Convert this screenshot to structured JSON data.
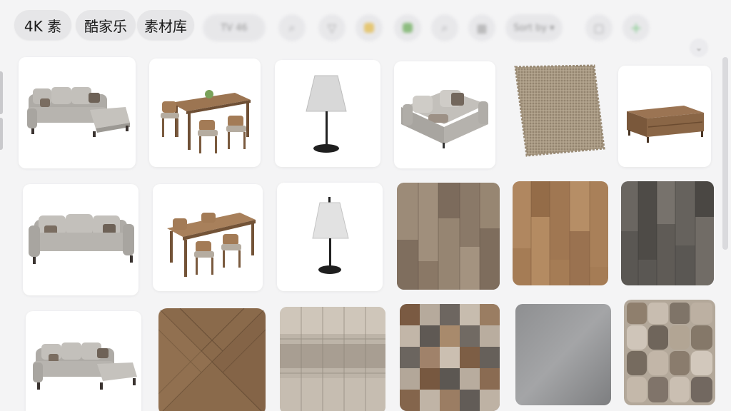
{
  "toolbar": {
    "chips": [
      {
        "label": "4K 素"
      },
      {
        "label": "酷家乐"
      },
      {
        "label": "素材库"
      }
    ],
    "blurred_pill_text": "TV 46",
    "blurred_dropdown_text": "Sort by ▾",
    "icons": [
      "search-icon",
      "filter-icon",
      "bell-icon",
      "palette-icon",
      "zoom-icon",
      "grid-icon",
      "sort-dropdown",
      "square-icon",
      "add-icon"
    ]
  },
  "grid": {
    "rows": [
      [
        "sectional-sofa",
        "dining-set",
        "table-lamp",
        "loveseat-sofa",
        "jute-rug",
        "coffee-table"
      ],
      [
        "three-seat-sofa",
        "dining-set",
        "table-lamp",
        "wood-floor-oak",
        "wood-floor-natural",
        "wood-floor-grey"
      ],
      [
        "sectional-sofa",
        "parquet-herringbone",
        "wood-pattern-panel",
        "checker-wood-tiles",
        "metal-plate",
        "stone-tile-mosaic"
      ]
    ]
  },
  "colors": {
    "background": "#f4f4f5",
    "accent_green": "#5fbf6a",
    "sofa": "#b9b7b2",
    "wood": "#8a6a4b"
  }
}
